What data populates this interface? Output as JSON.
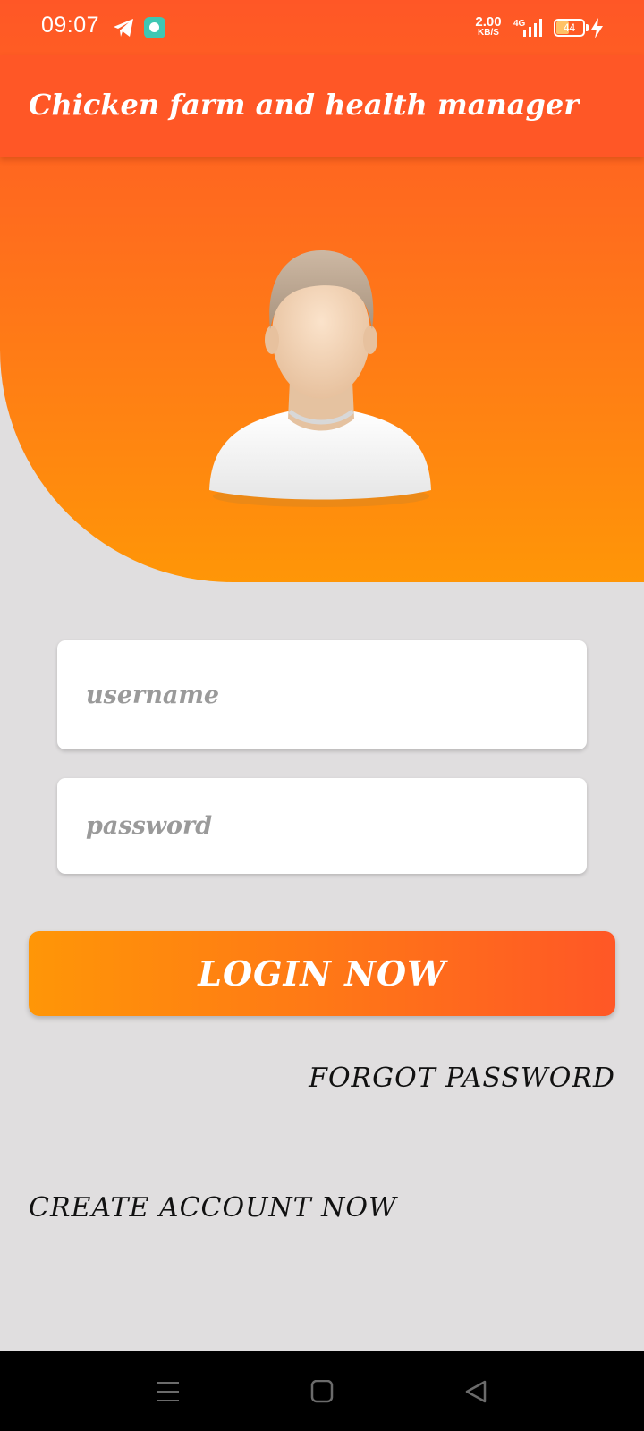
{
  "status_bar": {
    "time": "09:07",
    "net_speed_value": "2.00",
    "net_speed_unit": "KB/S",
    "network_type": "4G",
    "battery_level": "44",
    "battery_fraction": 0.44,
    "icons": [
      "telegram-icon",
      "chat-app-icon",
      "signal-icon",
      "battery-icon",
      "charging-icon"
    ]
  },
  "app_bar": {
    "title": "Chicken farm and health manager"
  },
  "colors": {
    "primary": "#ff5726",
    "accent": "#ff9607",
    "background": "#e0dedf"
  },
  "avatar": {
    "icon": "user-avatar-icon"
  },
  "form": {
    "username_placeholder": "username",
    "username_value": "",
    "password_placeholder": "password",
    "password_value": "",
    "login_label": "LOGIN NOW",
    "forgot_label": "FORGOT PASSWORD",
    "create_label": "CREATE ACCOUNT NOW"
  },
  "nav_bar": {
    "buttons": [
      "menu-icon",
      "home-icon",
      "back-icon"
    ]
  }
}
